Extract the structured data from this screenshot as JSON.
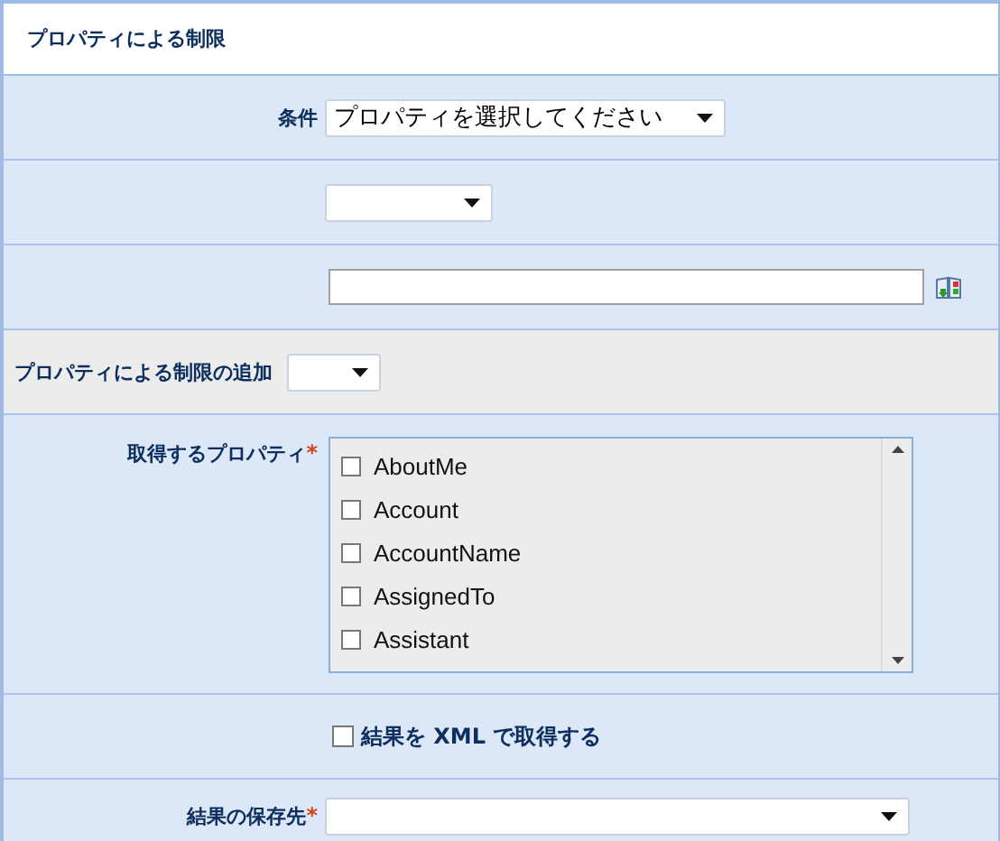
{
  "header": {
    "title": "プロパティによる制限"
  },
  "rows": [
    {
      "kind": "select",
      "label": "条件",
      "value": "プロパティを選択してください"
    },
    {
      "kind": "select"
    },
    {
      "kind": "text"
    },
    {
      "kind": "add",
      "label": "プロパティによる制限の追加"
    },
    {
      "kind": "checklist",
      "label": "取得するプロパティ",
      "required_mark": "*",
      "items": [
        {
          "label": "AboutMe",
          "checked": false
        },
        {
          "label": "Account",
          "checked": false
        },
        {
          "label": "AccountName",
          "checked": false
        },
        {
          "label": "AssignedTo",
          "checked": false
        },
        {
          "label": "Assistant",
          "checked": false
        }
      ]
    },
    {
      "kind": "checkbox",
      "label": "結果を XML で取得する",
      "checked": false
    },
    {
      "kind": "select",
      "label": "結果の保存先",
      "required_mark": "*"
    }
  ]
}
